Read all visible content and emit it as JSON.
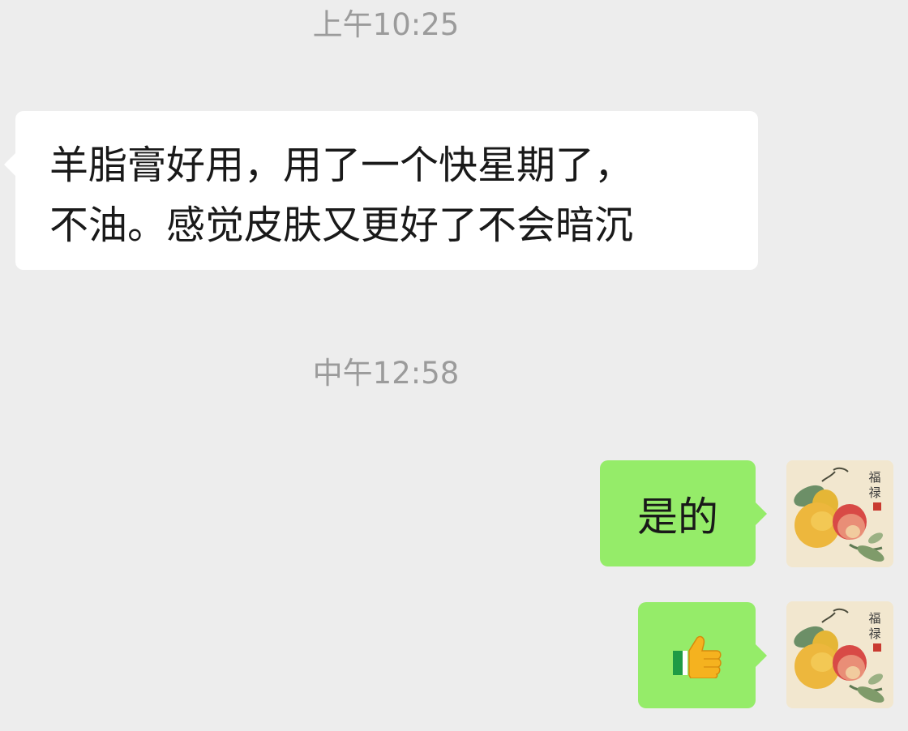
{
  "timestamps": [
    "上午10:25",
    "中午12:58"
  ],
  "messages": {
    "incoming": {
      "text": "羊脂膏好用，用了一个快星期了，\n不油。感觉皮肤又更好了不会暗沉"
    },
    "outgoing_1": {
      "text": "是的"
    },
    "outgoing_2": {
      "emoji": "thumbs-up"
    }
  },
  "avatar": {
    "calligraphy": "福禄",
    "description_icon": "gourd-and-peach-painting"
  },
  "colors": {
    "background": "#ededed",
    "incoming_bubble": "#ffffff",
    "outgoing_bubble": "#95ec69",
    "timestamp": "#9b9b9b"
  }
}
